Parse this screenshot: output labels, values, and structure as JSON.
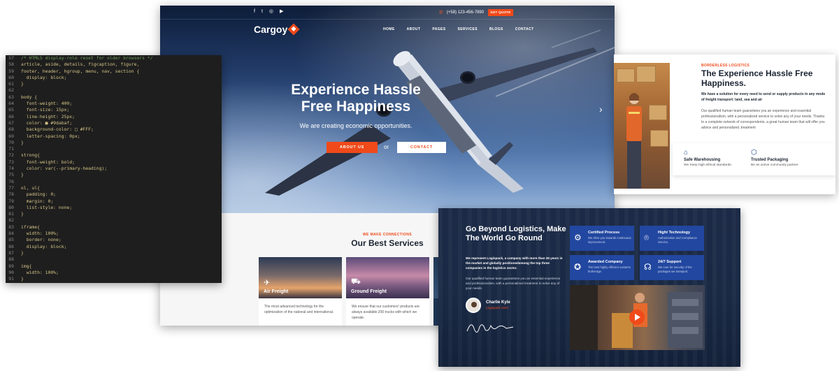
{
  "colors": {
    "accent": "#f04a1a",
    "navy": "#1b2432",
    "tile_blue": "#2247a0"
  },
  "cargoy": {
    "social_icons": [
      "f",
      "t",
      "◎",
      "▶"
    ],
    "social_icon_names": [
      "facebook-icon",
      "twitter-icon",
      "instagram-icon",
      "youtube-icon"
    ],
    "phone": "(+58) 123-456-7890",
    "quote_button": "GET QUOTE",
    "logo": "Cargoy",
    "nav": [
      "HOME",
      "ABOUT",
      "PAGES",
      "SERVICES",
      "BLOGS",
      "CONTACT"
    ],
    "hero_title_1": "Experience Hassle",
    "hero_title_2": "Free Happiness",
    "hero_subtitle": "We are creating economic opportunities.",
    "about_button": "ABOUT US",
    "or": "or",
    "contact_button": "CONTACT",
    "services_eyebrow": "WE MAKE CONNECTIONS",
    "services_title": "Our Best Services",
    "cards": [
      {
        "label": "Air Freight",
        "icon": "✈",
        "text": "The most advanced technology for the optimization of the national and international."
      },
      {
        "label": "Ground Freight",
        "icon": "⛟",
        "text": "We ensure that our customers' products are always available 200 trucks with which we operate."
      }
    ]
  },
  "code": {
    "lines": [
      {
        "n": "57",
        "t": "/* HTML5 display-role reset for older browsers */"
      },
      {
        "n": "58",
        "t": "article, aside, details, figcaption, figure,"
      },
      {
        "n": "59",
        "t": "footer, header, hgroup, menu, nav, section {"
      },
      {
        "n": "60",
        "t": "  display: block;"
      },
      {
        "n": "61",
        "t": "}"
      },
      {
        "n": "62",
        "t": ""
      },
      {
        "n": "63",
        "t": "body {"
      },
      {
        "n": "64",
        "t": "  font-weight: 400;"
      },
      {
        "n": "65",
        "t": "  font-size: 15px;"
      },
      {
        "n": "66",
        "t": "  line-height: 25px;"
      },
      {
        "n": "67",
        "t": "  color: ■ #9dabaf;"
      },
      {
        "n": "68",
        "t": "  background-color: □ #FFF;"
      },
      {
        "n": "69",
        "t": "  letter-spacing: 0px;"
      },
      {
        "n": "70",
        "t": "}"
      },
      {
        "n": "71",
        "t": ""
      },
      {
        "n": "72",
        "t": "strong{"
      },
      {
        "n": "73",
        "t": "  font-weight: bold;"
      },
      {
        "n": "74",
        "t": "  color: var(--primary-heading);"
      },
      {
        "n": "75",
        "t": "}"
      },
      {
        "n": "76",
        "t": ""
      },
      {
        "n": "77",
        "t": "ol, ul{"
      },
      {
        "n": "78",
        "t": "  padding: 0;"
      },
      {
        "n": "79",
        "t": "  margin: 0;"
      },
      {
        "n": "80",
        "t": "  list-style: none;"
      },
      {
        "n": "81",
        "t": "}"
      },
      {
        "n": "82",
        "t": ""
      },
      {
        "n": "83",
        "t": "iframe{"
      },
      {
        "n": "84",
        "t": "  width: 100%;"
      },
      {
        "n": "85",
        "t": "  border: none;"
      },
      {
        "n": "86",
        "t": "  display: block;"
      },
      {
        "n": "87",
        "t": "}"
      },
      {
        "n": "88",
        "t": ""
      },
      {
        "n": "89",
        "t": "img{"
      },
      {
        "n": "90",
        "t": "  width: 100%;"
      },
      {
        "n": "91",
        "t": "}"
      }
    ]
  },
  "borderless": {
    "eyebrow": "BORDERLESS LOGISTICS",
    "title": "The Experience Hassle Free Happiness.",
    "lead": "We have a solution for every need to send or supply products in any mode of freight transport: land, sea and air",
    "body": "Our qualified human team guarantees you an experience and essential professionalism, with a personalized service to solve any of your needs. Thanks to a complete network of correspondents, a great human team that will offer you advice and personalized. treatment",
    "features": [
      {
        "title": "Safe Warehousing",
        "desc": "We Keep high ethical standards.",
        "icon": "⌂"
      },
      {
        "title": "Trusted Packaging",
        "desc": "Be an active community partner.",
        "icon": "⬡"
      }
    ]
  },
  "beyond": {
    "title": "Go Beyond Logistics, Make The World Go Round",
    "lead": "We represent Logispack, a company with more than 35 years in the market and globally positionedamong the top three companies in the logistics sector.",
    "body": "Our qualified human team guarantees you an essential experience and professionalism, with a personalized treatment to solve any of your needs.",
    "person_name": "Charlie Kyle",
    "person_role": "Logispack CEO",
    "tiles": [
      {
        "title": "Certified Process",
        "desc": "We drive you towards continuous improvement.",
        "icon": "⚙"
      },
      {
        "title": "Hight Technology",
        "desc": "Authorization and Compliance Service.",
        "icon": "⌾"
      },
      {
        "title": "Awarded Company",
        "desc": "The best highly efficient customs brokerage.",
        "icon": "✪"
      },
      {
        "title": "24/7 Support",
        "desc": "We care for security of the packages we transport.",
        "icon": "☊"
      }
    ]
  }
}
